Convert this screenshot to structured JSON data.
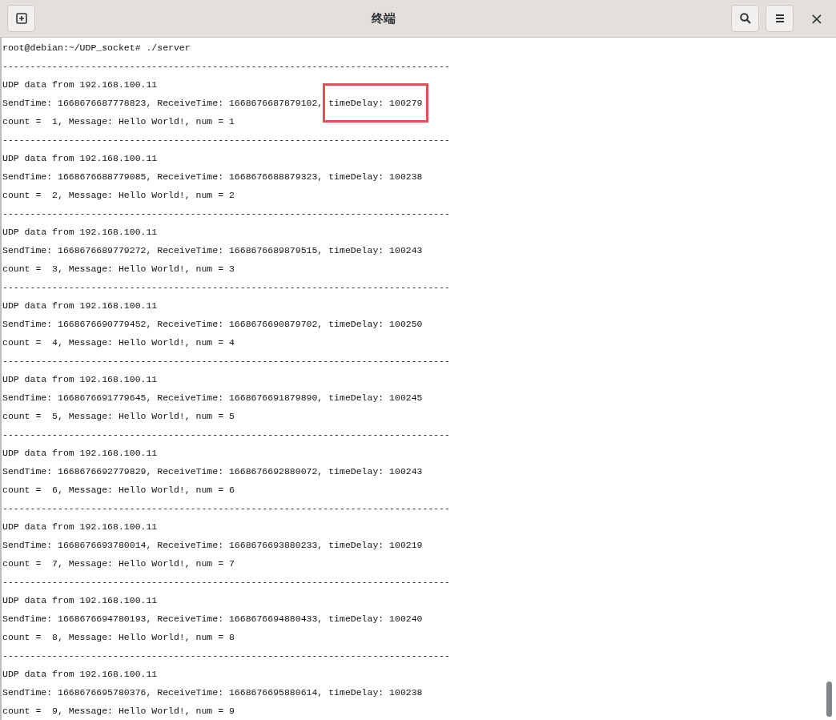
{
  "window": {
    "title": "终端",
    "close": "×"
  },
  "prompt": "root@debian:~/UDP_socket# ./server",
  "blocks": [
    {
      "separator": "---------------------------------------------------------------------------------",
      "from": "UDP data from 192.168.100.11",
      "timing": "SendTime: 1668676687778823, ReceiveTime: 1668676687879102, ",
      "delay": "timeDelay: 100279",
      "highlighted": true,
      "count": "count =  1, Message: Hello World!, num = 1"
    },
    {
      "separator": "---------------------------------------------------------------------------------",
      "from": "UDP data from 192.168.100.11",
      "timing": "SendTime: 1668676688779085, ReceiveTime: 1668676688879323, ",
      "delay": "timeDelay: 100238",
      "highlighted": false,
      "count": "count =  2, Message: Hello World!, num = 2"
    },
    {
      "separator": "---------------------------------------------------------------------------------",
      "from": "UDP data from 192.168.100.11",
      "timing": "SendTime: 1668676689779272, ReceiveTime: 1668676689879515, ",
      "delay": "timeDelay: 100243",
      "highlighted": false,
      "count": "count =  3, Message: Hello World!, num = 3"
    },
    {
      "separator": "---------------------------------------------------------------------------------",
      "from": "UDP data from 192.168.100.11",
      "timing": "SendTime: 1668676690779452, ReceiveTime: 1668676690879702, ",
      "delay": "timeDelay: 100250",
      "highlighted": false,
      "count": "count =  4, Message: Hello World!, num = 4"
    },
    {
      "separator": "---------------------------------------------------------------------------------",
      "from": "UDP data from 192.168.100.11",
      "timing": "SendTime: 1668676691779645, ReceiveTime: 1668676691879890, ",
      "delay": "timeDelay: 100245",
      "highlighted": false,
      "count": "count =  5, Message: Hello World!, num = 5"
    },
    {
      "separator": "---------------------------------------------------------------------------------",
      "from": "UDP data from 192.168.100.11",
      "timing": "SendTime: 1668676692779829, ReceiveTime: 1668676692880072, ",
      "delay": "timeDelay: 100243",
      "highlighted": false,
      "count": "count =  6, Message: Hello World!, num = 6"
    },
    {
      "separator": "---------------------------------------------------------------------------------",
      "from": "UDP data from 192.168.100.11",
      "timing": "SendTime: 1668676693780014, ReceiveTime: 1668676693880233, ",
      "delay": "timeDelay: 100219",
      "highlighted": false,
      "count": "count =  7, Message: Hello World!, num = 7"
    },
    {
      "separator": "---------------------------------------------------------------------------------",
      "from": "UDP data from 192.168.100.11",
      "timing": "SendTime: 1668676694780193, ReceiveTime: 1668676694880433, ",
      "delay": "timeDelay: 100240",
      "highlighted": false,
      "count": "count =  8, Message: Hello World!, num = 8"
    },
    {
      "separator": "---------------------------------------------------------------------------------",
      "from": "UDP data from 192.168.100.11",
      "timing": "SendTime: 1668676695780376, ReceiveTime: 1668676695880614, ",
      "delay": "timeDelay: 100238",
      "highlighted": false,
      "count": "count =  9, Message: Hello World!, num = 9"
    }
  ]
}
